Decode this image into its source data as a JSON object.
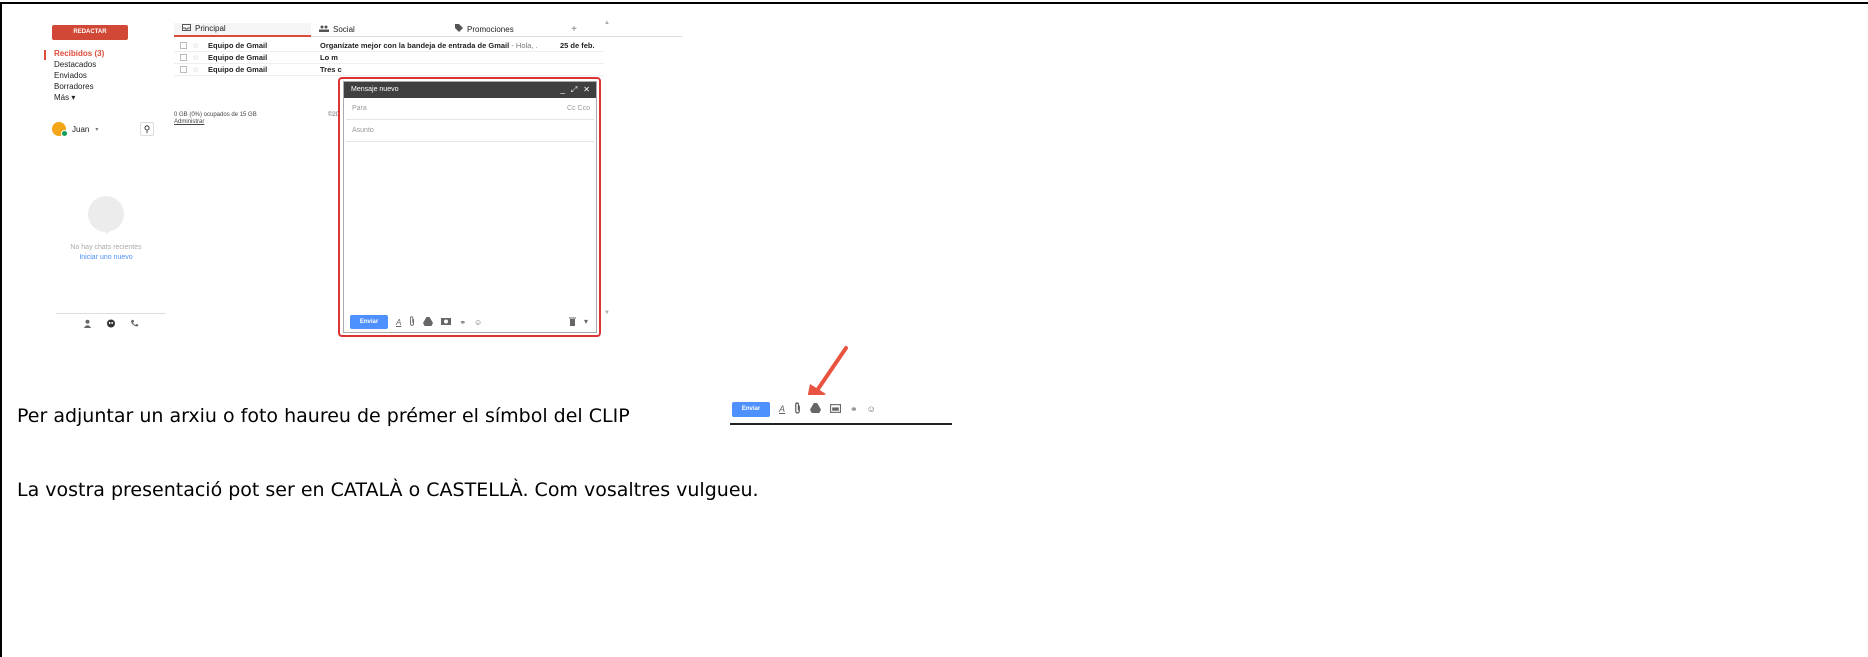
{
  "gmail": {
    "compose_label": "REDACTAR",
    "folders": [
      {
        "label": "Recibidos (3)",
        "active": true
      },
      {
        "label": "Destacados",
        "active": false
      },
      {
        "label": "Enviados",
        "active": false
      },
      {
        "label": "Borradores",
        "active": false
      },
      {
        "label": "Más ▾",
        "active": false
      }
    ],
    "user_name": "Juan",
    "user_caret": "▾",
    "search_icon_glyph": "⚲",
    "chat": {
      "empty_text": "No hay chats recientes",
      "new_link": "Iniciar uno nuevo"
    },
    "tabs": [
      {
        "label": "Principal",
        "icon": "inbox-icon"
      },
      {
        "label": "Social",
        "icon": "people-icon"
      },
      {
        "label": "Promociones",
        "icon": "tag-icon"
      }
    ],
    "tab_add": "+",
    "messages": [
      {
        "sender": "Equipo de Gmail",
        "subject": "Organízate mejor con la bandeja de entrada de Gmail",
        "snippet": " - Hola, .",
        "date": "25 de feb."
      },
      {
        "sender": "Equipo de Gmail",
        "subject": "Lo m",
        "snippet": "",
        "date": ""
      },
      {
        "sender": "Equipo de Gmail",
        "subject": "Tres c",
        "snippet": "",
        "date": ""
      }
    ],
    "storage_text": "0 GB (0%) ocupados de 15 GB",
    "manage_link": "Administrar",
    "copyright_fragment": "©20",
    "compose_window": {
      "title": "Mensaje nuevo",
      "to_placeholder": "Para",
      "cc_label": "Cc Cco",
      "subject_placeholder": "Asunto",
      "send_label": "Enviar"
    }
  },
  "doc": {
    "line1": "Per adjuntar un arxiu o foto haureu de prémer el símbol del CLIP",
    "line2": "La vostra presentació pot ser en CATALÀ o CASTELLÀ. Com vosaltres vulgueu."
  },
  "snippet": {
    "send_label": "Enviar"
  },
  "colors": {
    "gmail_red": "#dd4b39",
    "send_blue": "#4d90fe",
    "highlight_red": "#dd3333",
    "arrow_red": "#e8543f"
  }
}
